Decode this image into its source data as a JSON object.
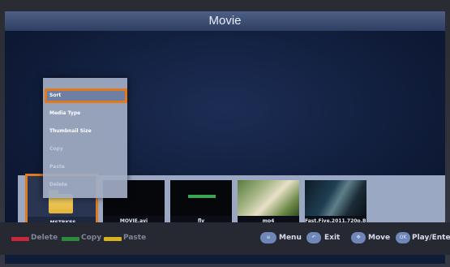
{
  "window": {
    "title": "Movie"
  },
  "files": [
    {
      "name": "_MSTBKFS",
      "kind": "folder-icon"
    },
    {
      "name": "MOVIE.avi",
      "kind": "video-thumbnail"
    },
    {
      "name": "flv",
      "kind": "video-thumbnail"
    },
    {
      "name": "mp4",
      "kind": "video-thumbnail"
    },
    {
      "name": "Fast.Five.2011.720p.B...",
      "kind": "video-thumbnail"
    }
  ],
  "context_menu": {
    "selected": "Sort",
    "items": [
      {
        "label": "Sort",
        "state": "selected"
      },
      {
        "label": "Media Type",
        "state": "enabled"
      },
      {
        "label": "Thumbnail Size",
        "state": "enabled"
      },
      {
        "label": "Copy",
        "state": "disabled"
      },
      {
        "label": "Paste",
        "state": "disabled"
      },
      {
        "label": "Delete",
        "state": "disabled"
      }
    ]
  },
  "footer": {
    "color_keys": [
      {
        "label": "Delete",
        "color": "#c8283a"
      },
      {
        "label": "Copy",
        "color": "#2e8a3a"
      },
      {
        "label": "Paste",
        "color": "#d8b21e"
      }
    ],
    "nav_hints": [
      {
        "label": "Menu",
        "icon": "menu-button-icon"
      },
      {
        "label": "Exit",
        "icon": "return-icon"
      },
      {
        "label": "Move",
        "icon": "dpad-icon"
      },
      {
        "label": "Play/Enter",
        "icon": "ok-button-icon"
      }
    ]
  },
  "colors": {
    "accent_selection": "#e07a1c",
    "screen_bg": "#0f1c3a",
    "title_bar": "#3d4e75"
  }
}
